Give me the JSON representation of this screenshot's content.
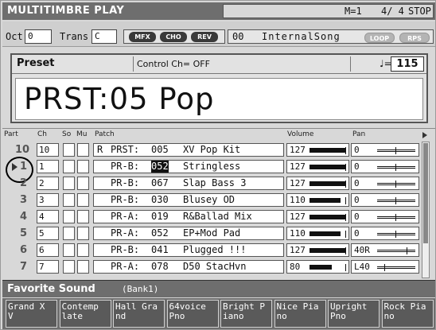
{
  "header": {
    "title": "MULTITIMBRE PLAY",
    "measure": "M=1",
    "time_signature": "4/ 4",
    "transport": "STOP"
  },
  "toolbar": {
    "oct_label": "Oct",
    "oct_value": "0",
    "trans_label": "Trans",
    "trans_value": "C",
    "fx": [
      "MFX",
      "CHO",
      "REV"
    ],
    "song_number": "00",
    "song_name": "InternalSong",
    "loop_label": "LOOP",
    "rps_label": "RPS"
  },
  "preset": {
    "label": "Preset",
    "control_channel": "Control Ch= OFF",
    "tempo_note": "♩=",
    "tempo": "115",
    "name": "PRST:05 Pop"
  },
  "table": {
    "headers": {
      "part": "Part",
      "ch": "Ch",
      "so": "So",
      "mu": "Mu",
      "patch": "Patch",
      "volume": "Volume",
      "pan": "Pan"
    },
    "rows": [
      {
        "part": "10",
        "ch": "10",
        "prefix": "R",
        "bank": "PRST:",
        "num": "005",
        "name": "XV Pop Kit",
        "volume": "127",
        "vol_level": 1.0,
        "pan": "0",
        "pan_pos": 0.5,
        "playing": false,
        "selected": false
      },
      {
        "part": "1",
        "ch": "1",
        "prefix": "",
        "bank": "PR-B:",
        "num": "052",
        "name": "Stringless",
        "volume": "127",
        "vol_level": 1.0,
        "pan": "0",
        "pan_pos": 0.5,
        "playing": true,
        "selected": true
      },
      {
        "part": "2",
        "ch": "2",
        "prefix": "",
        "bank": "PR-B:",
        "num": "067",
        "name": "Slap Bass 3",
        "volume": "127",
        "vol_level": 1.0,
        "pan": "0",
        "pan_pos": 0.5,
        "playing": false,
        "selected": false
      },
      {
        "part": "3",
        "ch": "3",
        "prefix": "",
        "bank": "PR-B:",
        "num": "030",
        "name": "Blusey OD",
        "volume": "110",
        "vol_level": 0.866,
        "pan": "0",
        "pan_pos": 0.5,
        "playing": false,
        "selected": false
      },
      {
        "part": "4",
        "ch": "4",
        "prefix": "",
        "bank": "PR-A:",
        "num": "019",
        "name": "R&Ballad Mix",
        "volume": "127",
        "vol_level": 1.0,
        "pan": "0",
        "pan_pos": 0.5,
        "playing": false,
        "selected": false
      },
      {
        "part": "5",
        "ch": "5",
        "prefix": "",
        "bank": "PR-A:",
        "num": "052",
        "name": "EP+Mod Pad",
        "volume": "110",
        "vol_level": 0.866,
        "pan": "0",
        "pan_pos": 0.5,
        "playing": false,
        "selected": false
      },
      {
        "part": "6",
        "ch": "6",
        "prefix": "",
        "bank": "PR-B:",
        "num": "041",
        "name": "Plugged !!!",
        "volume": "127",
        "vol_level": 1.0,
        "pan": "40R",
        "pan_pos": 0.81,
        "playing": false,
        "selected": false
      },
      {
        "part": "7",
        "ch": "7",
        "prefix": "",
        "bank": "PR-A:",
        "num": "078",
        "name": "D50 StacHvn",
        "volume": "80",
        "vol_level": 0.63,
        "pan": "L40",
        "pan_pos": 0.19,
        "playing": false,
        "selected": false
      }
    ]
  },
  "favorite": {
    "title": "Favorite Sound",
    "bank": "(Bank1)",
    "items": [
      [
        "Grand X",
        "V"
      ],
      [
        "Contemp",
        "late"
      ],
      [
        "Hall Gra",
        "nd"
      ],
      [
        "64voice",
        "Pno"
      ],
      [
        "Bright P",
        "iano"
      ],
      [
        "Nice Pia",
        "no"
      ],
      [
        "Upright",
        "Pno"
      ],
      [
        "Rock Pia",
        "no"
      ]
    ]
  }
}
